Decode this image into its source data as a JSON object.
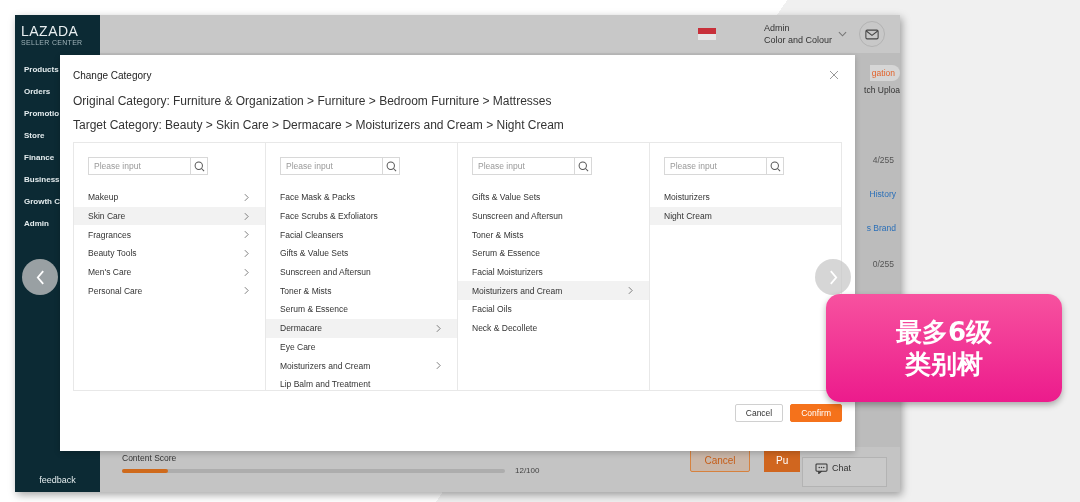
{
  "sidebar": {
    "logo": "LAZADA",
    "logo_sub": "SELLER CENTER",
    "items": [
      "Products",
      "Orders",
      "Promotio",
      "Store",
      "Finance",
      "Business",
      "Growth C",
      "Admin"
    ],
    "feedback": "feedback"
  },
  "topbar": {
    "user_role": "Admin",
    "user_name": "Color and Colour"
  },
  "background": {
    "right_texts": [
      {
        "text": "gation",
        "kind": "tab"
      },
      {
        "text": "tch Uploa",
        "kind": "text"
      },
      {
        "text": "4/255",
        "kind": "counter"
      },
      {
        "text": "History",
        "kind": "link"
      },
      {
        "text": "s Brand",
        "kind": "link"
      },
      {
        "text": "0/255",
        "kind": "counter"
      }
    ],
    "content_score": {
      "label": "Content Score",
      "level": 0.12,
      "reading": "12/100"
    },
    "cancel": "Cancel",
    "publish": "Pu",
    "chat": "Chat"
  },
  "modal": {
    "title": "Change Category",
    "original": "Original Category: Furniture & Organization > Furniture > Bedroom Furniture > Mattresses",
    "target": "Target Category: Beauty > Skin Care > Dermacare > Moisturizers and Cream > Night Cream",
    "columns": [
      {
        "placeholder": "Please input",
        "items": [
          {
            "label": "Makeup",
            "has_children": true,
            "selected": false
          },
          {
            "label": "Skin Care",
            "has_children": true,
            "selected": true
          },
          {
            "label": "Fragrances",
            "has_children": true,
            "selected": false
          },
          {
            "label": "Beauty Tools",
            "has_children": true,
            "selected": false
          },
          {
            "label": "Men's Care",
            "has_children": true,
            "selected": false
          },
          {
            "label": "Personal Care",
            "has_children": true,
            "selected": false
          }
        ]
      },
      {
        "placeholder": "Please input",
        "items": [
          {
            "label": "Face Mask & Packs",
            "has_children": false,
            "selected": false
          },
          {
            "label": "Face Scrubs & Exfoliators",
            "has_children": false,
            "selected": false
          },
          {
            "label": "Facial Cleansers",
            "has_children": false,
            "selected": false
          },
          {
            "label": "Gifts & Value Sets",
            "has_children": false,
            "selected": false
          },
          {
            "label": "Sunscreen and Aftersun",
            "has_children": false,
            "selected": false
          },
          {
            "label": "Toner & Mists",
            "has_children": false,
            "selected": false
          },
          {
            "label": "Serum & Essence",
            "has_children": false,
            "selected": false
          },
          {
            "label": "Dermacare",
            "has_children": true,
            "selected": true
          },
          {
            "label": "Eye Care",
            "has_children": false,
            "selected": false
          },
          {
            "label": "Moisturizers and Cream",
            "has_children": true,
            "selected": false
          },
          {
            "label": "Lip Balm and Treatment",
            "has_children": false,
            "selected": false
          }
        ]
      },
      {
        "placeholder": "Please input",
        "items": [
          {
            "label": "Gifts & Value Sets",
            "has_children": false,
            "selected": false
          },
          {
            "label": "Sunscreen and Aftersun",
            "has_children": false,
            "selected": false
          },
          {
            "label": "Toner & Mists",
            "has_children": false,
            "selected": false
          },
          {
            "label": "Serum & Essence",
            "has_children": false,
            "selected": false
          },
          {
            "label": "Facial Moisturizers",
            "has_children": false,
            "selected": false
          },
          {
            "label": "Moisturizers and Cream",
            "has_children": true,
            "selected": true
          },
          {
            "label": "Facial Oils",
            "has_children": false,
            "selected": false
          },
          {
            "label": "Neck & Decollete",
            "has_children": false,
            "selected": false
          }
        ]
      },
      {
        "placeholder": "Please input",
        "items": [
          {
            "label": "Moisturizers",
            "has_children": false,
            "selected": false
          },
          {
            "label": "Night Cream",
            "has_children": false,
            "selected": true
          }
        ]
      }
    ],
    "buttons": [
      {
        "label": "Cancel",
        "kind": "secondary"
      },
      {
        "label": "Confirm",
        "kind": "primary"
      }
    ]
  },
  "badge": {
    "lines": [
      "最多6级",
      "类别树"
    ]
  }
}
